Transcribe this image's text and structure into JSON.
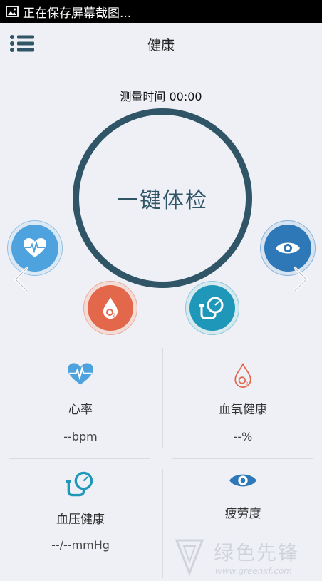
{
  "status_bar": {
    "notification": "正在保存屏幕截图..."
  },
  "header": {
    "title": "健康"
  },
  "timer": {
    "label": "测量时间 00:00"
  },
  "main": {
    "checkup_label": "一键体检"
  },
  "metrics": [
    {
      "label": "心率",
      "value": "--bpm"
    },
    {
      "label": "血氧健康",
      "value": "--%"
    },
    {
      "label": "血压健康",
      "value": "--/--mmHg"
    },
    {
      "label": "疲劳度",
      "value": ""
    }
  ],
  "watermark": {
    "text": "绿色先锋",
    "url": "www.greenxf.com"
  },
  "colors": {
    "background": "#eef0f6",
    "ring": "#2f5566",
    "heart": "#4ea2dd",
    "oxygen": "#e2674b",
    "pressure": "#1f97b8",
    "fatigue": "#2f78b8",
    "divider": "#d9dbe1"
  },
  "icons": [
    "image-icon",
    "menu-list-icon",
    "heart-pulse-icon",
    "blood-drop-icon",
    "blood-pressure-icon",
    "eye-icon",
    "chevron-left-icon",
    "chevron-right-icon"
  ]
}
